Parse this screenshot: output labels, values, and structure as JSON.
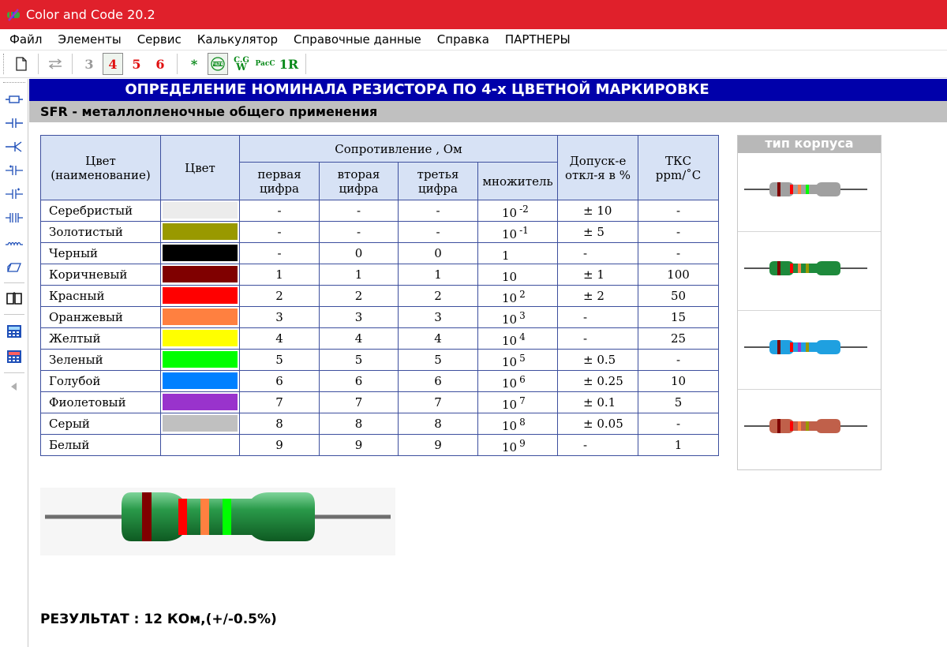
{
  "window": {
    "title": "Color and Code 20.2"
  },
  "menu": [
    "Файл",
    "Элементы",
    "Сервис",
    "Калькулятор",
    "Справочные данные",
    "Справка",
    "ПАРТНЕРЫ"
  ],
  "toolbar": {
    "band3": "3",
    "band4": "4",
    "band5": "5",
    "band6": "6",
    "star": "*",
    "cg": "C.G",
    "w": "W",
    "pac": "PacC",
    "one_r": "1R"
  },
  "banner": "ОПРЕДЕЛЕНИЕ НОМИНАЛА РЕЗИСТОРА ПО 4-х ЦВЕТНОЙ МАРКИРОВКЕ",
  "subtitle": "SFR - металлопленочные общего применения",
  "table": {
    "headers": {
      "color_name": "Цвет\n(наименование)",
      "color": "Цвет",
      "resistance": "Сопротивление , Ом",
      "first": "первая\nцифра",
      "second": "вторая\nцифра",
      "third": "третья\nцифра",
      "multiplier": "множитель",
      "tolerance": "Допуск-е\nоткл-я в %",
      "tcr": "ТКС\nppm/˚C"
    },
    "rows": [
      {
        "name": "Серебристый",
        "swatch": "#ececec",
        "d1": "-",
        "d2": "-",
        "d3": "-",
        "mult_base": "10",
        "mult_exp": "-2",
        "tol": "± 10",
        "tcr": "-"
      },
      {
        "name": "Золотистый",
        "swatch": "#999900",
        "d1": "-",
        "d2": "-",
        "d3": "-",
        "mult_base": "10",
        "mult_exp": "-1",
        "tol": "± 5",
        "tcr": "-"
      },
      {
        "name": "Черный",
        "swatch": "#000000",
        "d1": "-",
        "d2": "0",
        "d3": "0",
        "mult_base": "1",
        "mult_exp": "",
        "tol": "-",
        "tcr": "-"
      },
      {
        "name": "Коричневый",
        "swatch": "#800000",
        "d1": "1",
        "d2": "1",
        "d3": "1",
        "mult_base": "10",
        "mult_exp": "",
        "tol": "± 1",
        "tcr": "100"
      },
      {
        "name": "Красный",
        "swatch": "#ff0000",
        "d1": "2",
        "d2": "2",
        "d3": "2",
        "mult_base": "10",
        "mult_exp": "2",
        "tol": "± 2",
        "tcr": "50"
      },
      {
        "name": "Оранжевый",
        "swatch": "#ff8040",
        "d1": "3",
        "d2": "3",
        "d3": "3",
        "mult_base": "10",
        "mult_exp": "3",
        "tol": "-",
        "tcr": "15"
      },
      {
        "name": "Желтый",
        "swatch": "#ffff00",
        "d1": "4",
        "d2": "4",
        "d3": "4",
        "mult_base": "10",
        "mult_exp": "4",
        "tol": "-",
        "tcr": "25"
      },
      {
        "name": "Зеленый",
        "swatch": "#00ff00",
        "d1": "5",
        "d2": "5",
        "d3": "5",
        "mult_base": "10",
        "mult_exp": "5",
        "tol": "± 0.5",
        "tcr": "-"
      },
      {
        "name": "Голубой",
        "swatch": "#0080ff",
        "d1": "6",
        "d2": "6",
        "d3": "6",
        "mult_base": "10",
        "mult_exp": "6",
        "tol": "± 0.25",
        "tcr": "10"
      },
      {
        "name": "Фиолетовый",
        "swatch": "#9933cc",
        "d1": "7",
        "d2": "7",
        "d3": "7",
        "mult_base": "10",
        "mult_exp": "7",
        "tol": "± 0.1",
        "tcr": "5"
      },
      {
        "name": "Серый",
        "swatch": "#c0c0c0",
        "d1": "8",
        "d2": "8",
        "d3": "8",
        "mult_base": "10",
        "mult_exp": "8",
        "tol": "± 0.05",
        "tcr": "-"
      },
      {
        "name": "Белый",
        "swatch": "#ffffff",
        "d1": "9",
        "d2": "9",
        "d3": "9",
        "mult_base": "10",
        "mult_exp": "9",
        "tol": "-",
        "tcr": "1"
      }
    ]
  },
  "case_panel": {
    "title": "тип корпуса",
    "bodies": [
      "#a0a0a0",
      "#1e8a3c",
      "#1fa0e0",
      "#c0604a"
    ]
  },
  "selected_bands": [
    "#800000",
    "#ff0000",
    "#ff8040",
    "#00ff00"
  ],
  "resistor_body_color": "#1e8a3c",
  "result": "РЕЗУЛЬТАТ : 12 КОм,(+/-0.5%)",
  "colors": {
    "title_bar": "#e0202b",
    "banner": "#0000aa",
    "table_border": "#3d4f9e",
    "header_bg": "#d7e2f5"
  }
}
